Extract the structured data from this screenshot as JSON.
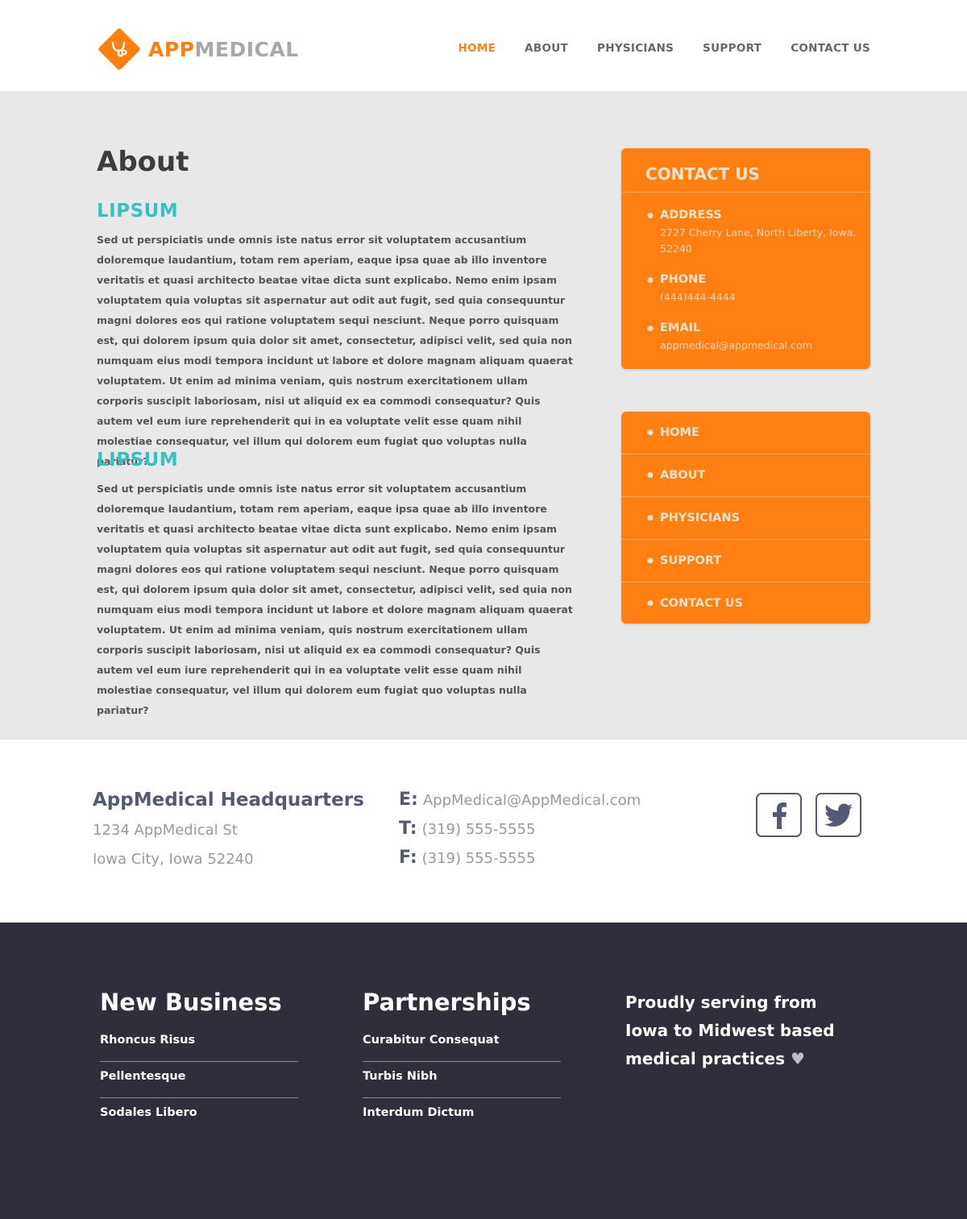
{
  "brand": {
    "app": "APP",
    "medical": "MEDICAL",
    "accent": "#ff7f11",
    "secondary": "#36c2c2"
  },
  "nav": [
    {
      "label": "HOME",
      "active": true
    },
    {
      "label": "ABOUT"
    },
    {
      "label": "PHYSICIANS"
    },
    {
      "label": "SUPPORT"
    },
    {
      "label": "CONTACT US"
    }
  ],
  "page": {
    "title": "About"
  },
  "articles": [
    {
      "heading": "LIPSUM",
      "body": "Sed ut perspiciatis unde omnis iste natus error sit voluptatem accusantium doloremque laudantium, totam rem aperiam, eaque ipsa quae ab illo inventore veritatis et quasi architecto beatae vitae dicta sunt explicabo. Nemo enim ipsam voluptatem quia voluptas sit aspernatur aut odit aut fugit, sed quia consequuntur magni dolores eos qui ratione voluptatem sequi nesciunt. Neque porro quisquam est, qui dolorem ipsum quia dolor sit amet, consectetur, adipisci velit, sed quia non numquam eius modi tempora incidunt ut labore et dolore magnam aliquam quaerat voluptatem. Ut enim ad minima veniam, quis nostrum exercitationem ullam corporis suscipit laboriosam, nisi ut aliquid ex ea commodi consequatur? Quis autem vel eum iure reprehenderit qui in ea voluptate velit esse quam nihil molestiae consequatur, vel illum qui dolorem eum fugiat quo voluptas nulla pariatur?"
    },
    {
      "heading": "LIPSUM",
      "body": "Sed ut perspiciatis unde omnis iste natus error sit voluptatem accusantium doloremque laudantium, totam rem aperiam, eaque ipsa quae ab illo inventore veritatis et quasi architecto beatae vitae dicta sunt explicabo. Nemo enim ipsam voluptatem quia voluptas sit aspernatur aut odit aut fugit, sed quia consequuntur magni dolores eos qui ratione voluptatem sequi nesciunt. Neque porro quisquam est, qui dolorem ipsum quia dolor sit amet, consectetur, adipisci velit, sed quia non numquam eius modi tempora incidunt ut labore et dolore magnam aliquam quaerat voluptatem. Ut enim ad minima veniam, quis nostrum exercitationem ullam corporis suscipit laboriosam, nisi ut aliquid ex ea commodi consequatur? Quis autem vel eum iure reprehenderit qui in ea voluptate velit esse quam nihil molestiae consequatur, vel illum qui dolorem eum fugiat quo voluptas nulla pariatur?"
    }
  ],
  "sidebar": {
    "contact_title": "CONTACT US",
    "address_label": "ADDRESS",
    "address_value": "2727 Cherry Lane, North Liberty, Iowa, 52240",
    "phone_label": "PHONE",
    "phone_value": "(444)444-4444",
    "email_label": "EMAIL",
    "email_value": "appmedical@appmedical.com",
    "nav": [
      "HOME",
      "ABOUT",
      "PHYSICIANS",
      "SUPPORT",
      "CONTACT US"
    ]
  },
  "hq": {
    "title": "AppMedical Headquarters",
    "street": "1234 AppMedical St",
    "city": "Iowa City, Iowa 52240",
    "email_prefix": "E:",
    "email": "AppMedical@AppMedical.com",
    "phone_prefix": "T:",
    "phone": "(319) 555-5555",
    "fax_prefix": "F:",
    "fax": "(319) 555-5555",
    "social": [
      "facebook-icon",
      "twitter-icon"
    ]
  },
  "footer": {
    "col1": {
      "title": "New Business",
      "links": [
        "Rhoncus Risus",
        "Pellentesque",
        "Sodales Libero"
      ]
    },
    "col2": {
      "title": "Partnerships",
      "links": [
        "Curabitur Consequat",
        "Turbis Nibh",
        "Interdum Dictum"
      ]
    },
    "tagline": "Proudly serving from Iowa to Midwest based medical practices",
    "heart": "♥"
  }
}
